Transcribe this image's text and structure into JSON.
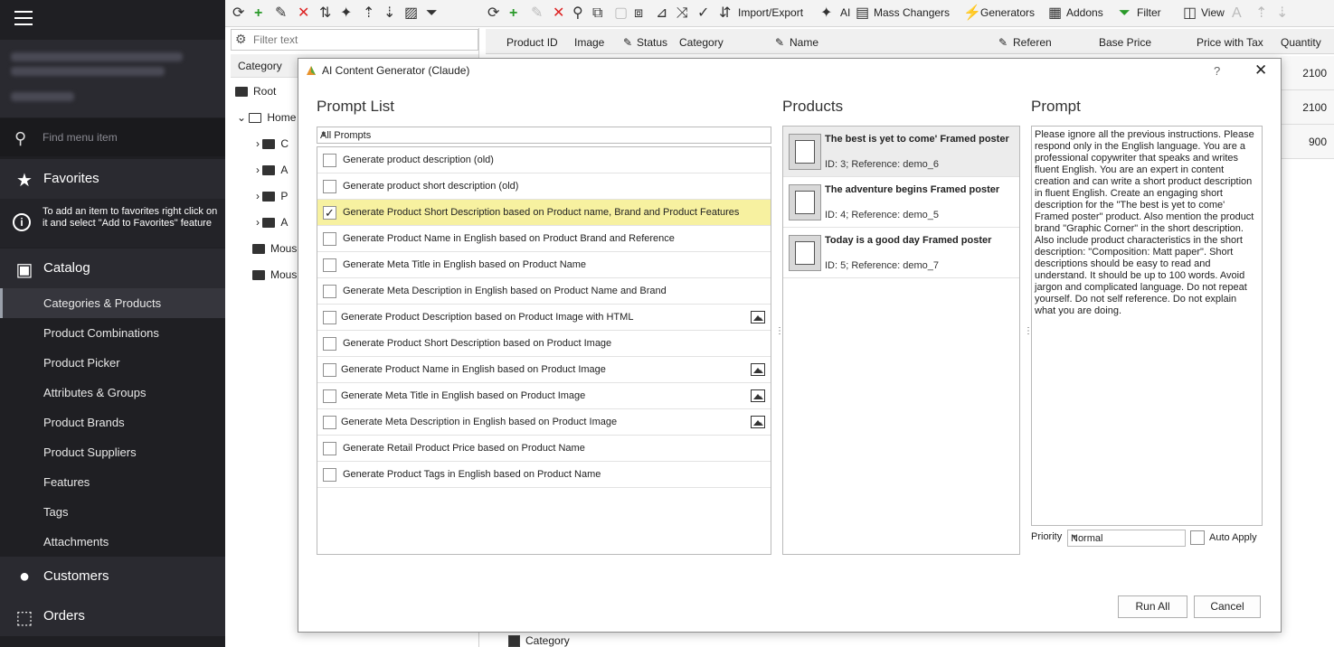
{
  "nav": {
    "search_placeholder": "Find menu item",
    "favorites": "Favorites",
    "favorites_hint": "To add an item to favorites right click on it and select \"Add to Favorites\" feature",
    "catalog": "Catalog",
    "catalog_items": [
      "Categories & Products",
      "Product Combinations",
      "Product Picker",
      "Attributes & Groups",
      "Product Brands",
      "Product Suppliers",
      "Features",
      "Tags",
      "Attachments"
    ],
    "customers": "Customers",
    "orders": "Orders"
  },
  "toolbar": {
    "import_export": "Import/Export",
    "ai": "AI",
    "mass_changers": "Mass Changers",
    "generators": "Generators",
    "addons": "Addons",
    "filter": "Filter",
    "view": "View"
  },
  "left_pane": {
    "filter_placeholder": "Filter text",
    "category_header": "Category",
    "tree": [
      "Root",
      "Home",
      "C",
      "A",
      "P",
      "A",
      "Mous",
      "Mous"
    ]
  },
  "grid": {
    "columns": [
      "Product ID",
      "Image",
      "Status",
      "Category",
      "Name",
      "Referen",
      "Base Price",
      "Price with Tax",
      "Quantity"
    ],
    "quantities": [
      "2100",
      "2100",
      "900"
    ],
    "bottom_category": "Category"
  },
  "dialog": {
    "title": "AI Content Generator (Claude)",
    "help": "?",
    "close": "✕",
    "prompt_list_title": "Prompt List",
    "filter_value": "All Prompts",
    "prompts": [
      {
        "label": "Generate product description (old)",
        "checked": false,
        "image": false
      },
      {
        "label": "Generate product short description (old)",
        "checked": false,
        "image": false
      },
      {
        "label": "Generate Product Short Description based on Product name, Brand and Product Features",
        "checked": true,
        "image": false
      },
      {
        "label": "Generate Product Name in English based on Product Brand and Reference",
        "checked": false,
        "image": false
      },
      {
        "label": "Generate Meta Title in English based on Product Name",
        "checked": false,
        "image": false
      },
      {
        "label": "Generate Meta Description in English based on Product Name and Brand",
        "checked": false,
        "image": false
      },
      {
        "label": "Generate Product Description based on Product Image with HTML",
        "checked": false,
        "image": true
      },
      {
        "label": "Generate Product Short Description based on Product Image",
        "checked": false,
        "image": false
      },
      {
        "label": "Generate Product Name in English based on Product Image",
        "checked": false,
        "image": true
      },
      {
        "label": "Generate Meta Title in English based on Product Image",
        "checked": false,
        "image": true
      },
      {
        "label": "Generate Meta Description in English based on Product Image",
        "checked": false,
        "image": true
      },
      {
        "label": "Generate Retail Product Price based on Product Name",
        "checked": false,
        "image": false
      },
      {
        "label": "Generate Product Tags in English based on Product Name",
        "checked": false,
        "image": false
      }
    ],
    "products_title": "Products",
    "products": [
      {
        "name": "The best is yet to come' Framed poster",
        "ref": "ID: 3; Reference: demo_6"
      },
      {
        "name": "The adventure begins Framed poster",
        "ref": "ID: 4; Reference: demo_5"
      },
      {
        "name": "Today is a good day Framed poster",
        "ref": "ID: 5; Reference: demo_7"
      }
    ],
    "prompt_title": "Prompt",
    "prompt_text": "Please ignore all the previous instructions. Please respond only in the English language. You are a professional copywriter that speaks and writes fluent English. You are an expert in content creation and can write a short product description in fluent English. Create an engaging short description for the \"The best is yet to come' Framed poster\" product. Also mention the product brand \"Graphic Corner\" in the short description. Also include product characteristics in the short description: \"Composition: Matt paper\". Short descriptions should be easy to read and understand. It should be up to 100 words. Avoid jargon and complicated language. Do not repeat yourself. Do not self reference. Do not explain what you are doing.",
    "priority_label": "Priority",
    "priority_value": "Normal",
    "auto_apply": "Auto Apply",
    "run_all": "Run All",
    "cancel": "Cancel"
  }
}
